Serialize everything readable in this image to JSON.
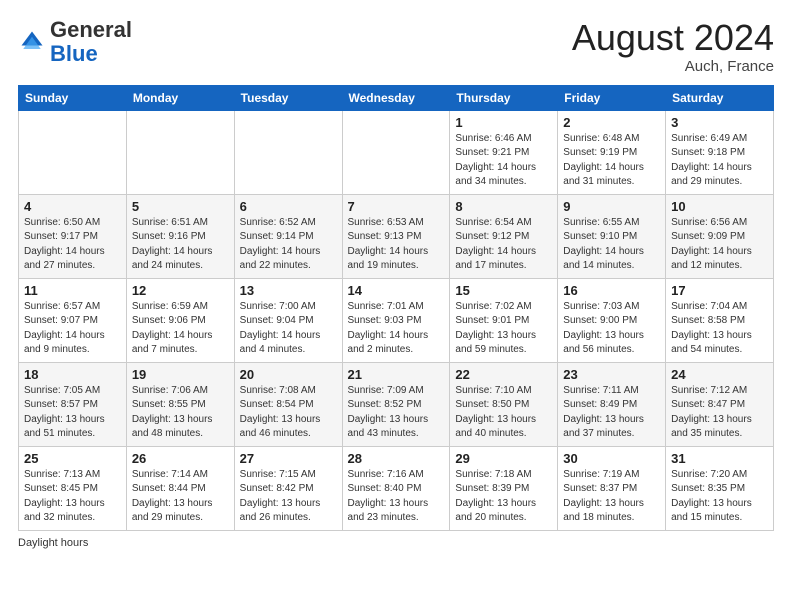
{
  "header": {
    "logo_general": "General",
    "logo_blue": "Blue",
    "month_year": "August 2024",
    "location": "Auch, France"
  },
  "weekdays": [
    "Sunday",
    "Monday",
    "Tuesday",
    "Wednesday",
    "Thursday",
    "Friday",
    "Saturday"
  ],
  "weeks": [
    [
      {
        "day": "",
        "sunrise": "",
        "sunset": "",
        "daylight": ""
      },
      {
        "day": "",
        "sunrise": "",
        "sunset": "",
        "daylight": ""
      },
      {
        "day": "",
        "sunrise": "",
        "sunset": "",
        "daylight": ""
      },
      {
        "day": "",
        "sunrise": "",
        "sunset": "",
        "daylight": ""
      },
      {
        "day": "1",
        "sunrise": "Sunrise: 6:46 AM",
        "sunset": "Sunset: 9:21 PM",
        "daylight": "Daylight: 14 hours and 34 minutes."
      },
      {
        "day": "2",
        "sunrise": "Sunrise: 6:48 AM",
        "sunset": "Sunset: 9:19 PM",
        "daylight": "Daylight: 14 hours and 31 minutes."
      },
      {
        "day": "3",
        "sunrise": "Sunrise: 6:49 AM",
        "sunset": "Sunset: 9:18 PM",
        "daylight": "Daylight: 14 hours and 29 minutes."
      }
    ],
    [
      {
        "day": "4",
        "sunrise": "Sunrise: 6:50 AM",
        "sunset": "Sunset: 9:17 PM",
        "daylight": "Daylight: 14 hours and 27 minutes."
      },
      {
        "day": "5",
        "sunrise": "Sunrise: 6:51 AM",
        "sunset": "Sunset: 9:16 PM",
        "daylight": "Daylight: 14 hours and 24 minutes."
      },
      {
        "day": "6",
        "sunrise": "Sunrise: 6:52 AM",
        "sunset": "Sunset: 9:14 PM",
        "daylight": "Daylight: 14 hours and 22 minutes."
      },
      {
        "day": "7",
        "sunrise": "Sunrise: 6:53 AM",
        "sunset": "Sunset: 9:13 PM",
        "daylight": "Daylight: 14 hours and 19 minutes."
      },
      {
        "day": "8",
        "sunrise": "Sunrise: 6:54 AM",
        "sunset": "Sunset: 9:12 PM",
        "daylight": "Daylight: 14 hours and 17 minutes."
      },
      {
        "day": "9",
        "sunrise": "Sunrise: 6:55 AM",
        "sunset": "Sunset: 9:10 PM",
        "daylight": "Daylight: 14 hours and 14 minutes."
      },
      {
        "day": "10",
        "sunrise": "Sunrise: 6:56 AM",
        "sunset": "Sunset: 9:09 PM",
        "daylight": "Daylight: 14 hours and 12 minutes."
      }
    ],
    [
      {
        "day": "11",
        "sunrise": "Sunrise: 6:57 AM",
        "sunset": "Sunset: 9:07 PM",
        "daylight": "Daylight: 14 hours and 9 minutes."
      },
      {
        "day": "12",
        "sunrise": "Sunrise: 6:59 AM",
        "sunset": "Sunset: 9:06 PM",
        "daylight": "Daylight: 14 hours and 7 minutes."
      },
      {
        "day": "13",
        "sunrise": "Sunrise: 7:00 AM",
        "sunset": "Sunset: 9:04 PM",
        "daylight": "Daylight: 14 hours and 4 minutes."
      },
      {
        "day": "14",
        "sunrise": "Sunrise: 7:01 AM",
        "sunset": "Sunset: 9:03 PM",
        "daylight": "Daylight: 14 hours and 2 minutes."
      },
      {
        "day": "15",
        "sunrise": "Sunrise: 7:02 AM",
        "sunset": "Sunset: 9:01 PM",
        "daylight": "Daylight: 13 hours and 59 minutes."
      },
      {
        "day": "16",
        "sunrise": "Sunrise: 7:03 AM",
        "sunset": "Sunset: 9:00 PM",
        "daylight": "Daylight: 13 hours and 56 minutes."
      },
      {
        "day": "17",
        "sunrise": "Sunrise: 7:04 AM",
        "sunset": "Sunset: 8:58 PM",
        "daylight": "Daylight: 13 hours and 54 minutes."
      }
    ],
    [
      {
        "day": "18",
        "sunrise": "Sunrise: 7:05 AM",
        "sunset": "Sunset: 8:57 PM",
        "daylight": "Daylight: 13 hours and 51 minutes."
      },
      {
        "day": "19",
        "sunrise": "Sunrise: 7:06 AM",
        "sunset": "Sunset: 8:55 PM",
        "daylight": "Daylight: 13 hours and 48 minutes."
      },
      {
        "day": "20",
        "sunrise": "Sunrise: 7:08 AM",
        "sunset": "Sunset: 8:54 PM",
        "daylight": "Daylight: 13 hours and 46 minutes."
      },
      {
        "day": "21",
        "sunrise": "Sunrise: 7:09 AM",
        "sunset": "Sunset: 8:52 PM",
        "daylight": "Daylight: 13 hours and 43 minutes."
      },
      {
        "day": "22",
        "sunrise": "Sunrise: 7:10 AM",
        "sunset": "Sunset: 8:50 PM",
        "daylight": "Daylight: 13 hours and 40 minutes."
      },
      {
        "day": "23",
        "sunrise": "Sunrise: 7:11 AM",
        "sunset": "Sunset: 8:49 PM",
        "daylight": "Daylight: 13 hours and 37 minutes."
      },
      {
        "day": "24",
        "sunrise": "Sunrise: 7:12 AM",
        "sunset": "Sunset: 8:47 PM",
        "daylight": "Daylight: 13 hours and 35 minutes."
      }
    ],
    [
      {
        "day": "25",
        "sunrise": "Sunrise: 7:13 AM",
        "sunset": "Sunset: 8:45 PM",
        "daylight": "Daylight: 13 hours and 32 minutes."
      },
      {
        "day": "26",
        "sunrise": "Sunrise: 7:14 AM",
        "sunset": "Sunset: 8:44 PM",
        "daylight": "Daylight: 13 hours and 29 minutes."
      },
      {
        "day": "27",
        "sunrise": "Sunrise: 7:15 AM",
        "sunset": "Sunset: 8:42 PM",
        "daylight": "Daylight: 13 hours and 26 minutes."
      },
      {
        "day": "28",
        "sunrise": "Sunrise: 7:16 AM",
        "sunset": "Sunset: 8:40 PM",
        "daylight": "Daylight: 13 hours and 23 minutes."
      },
      {
        "day": "29",
        "sunrise": "Sunrise: 7:18 AM",
        "sunset": "Sunset: 8:39 PM",
        "daylight": "Daylight: 13 hours and 20 minutes."
      },
      {
        "day": "30",
        "sunrise": "Sunrise: 7:19 AM",
        "sunset": "Sunset: 8:37 PM",
        "daylight": "Daylight: 13 hours and 18 minutes."
      },
      {
        "day": "31",
        "sunrise": "Sunrise: 7:20 AM",
        "sunset": "Sunset: 8:35 PM",
        "daylight": "Daylight: 13 hours and 15 minutes."
      }
    ]
  ],
  "footer": {
    "note": "Daylight hours"
  }
}
